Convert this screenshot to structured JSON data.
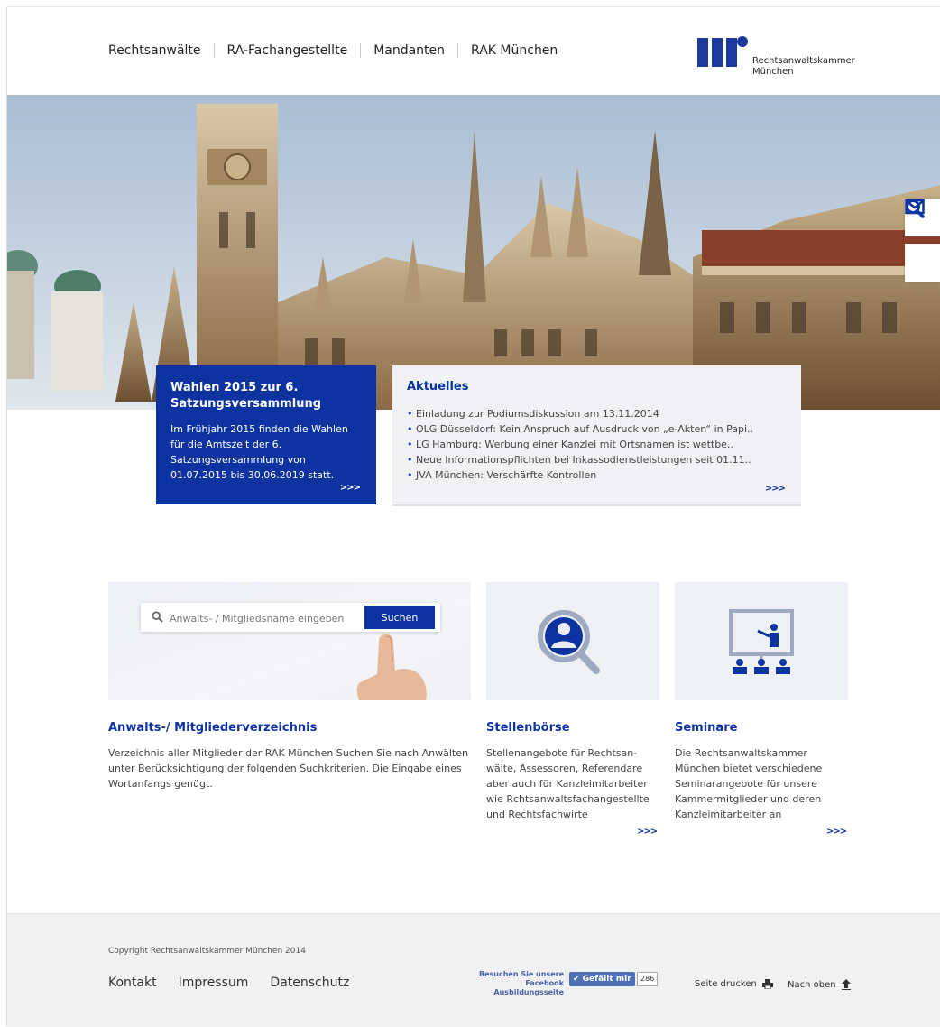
{
  "header": {
    "nav": [
      "Rechtsanwälte",
      "RA-Fachangestellte",
      "Mandanten",
      "RAK München"
    ],
    "logo_line1": "Rechtsanwaltskammer",
    "logo_line2": "München"
  },
  "wahlen": {
    "title": "Wahlen 2015 zur 6. Satzungsversammlung",
    "text": "Im Frühjahr 2015 finden die Wahlen für die Amtszeit der 6. Satzungsversammlung von 01.07.2015 bis 30.06.2019 statt.",
    "more": ">>>"
  },
  "aktuelles": {
    "title": "Aktuelles",
    "items": [
      "Einladung zur Podiumsdiskussion am 13.11.2014",
      "OLG Düsseldorf: Kein Anspruch auf Ausdruck von „e-Akten“ in Papi..",
      "LG Hamburg: Werbung einer Kanzlei mit Ortsnamen ist wettbe..",
      "Neue Informationspflichten bei Inkassodienstleistungen seit 01.11..",
      "JVA München: Verschärfte Kontrollen"
    ],
    "more": ">>>"
  },
  "search": {
    "placeholder": "Anwalts- / Mitgliedsname eingeben",
    "button": "Suchen"
  },
  "columns": [
    {
      "title": "Anwalts-/ Mitgliederverzeichnis",
      "text": "Verzeichnis aller Mitglieder der RAK München Suchen Sie nach Anwälten unter Berücksichtigung der folgenden Suchkriterien. Die Eingabe eines Wortanfangs genügt."
    },
    {
      "title": "Stellenbörse",
      "text": "Stellenangebote für Rechtsan-wälte, Assessoren, Referendare aber auch für Kanzleimitarbeiter wie Rchtsanwaltsfachangestellte und Rechtsfachwirte",
      "more": ">>>"
    },
    {
      "title": "Seminare",
      "text": "Die Rechtsanwaltskammer München bietet verschiedene Seminarangebote für unsere Kammermitglieder und deren Kanzleimitarbeiter an",
      "more": ">>>"
    }
  ],
  "footer": {
    "copyright": "Copyright Rechtsanwaltskammer München 2014",
    "nav": [
      "Kontakt",
      "Impressum",
      "Datenschutz"
    ],
    "fb_line1": "Besuchen Sie unsere",
    "fb_line2": "Facebook Ausbildungsseite",
    "fb_button": "✔ Gefällt mir",
    "fb_count": "286",
    "print": "Seite drucken",
    "top": "Nach oben"
  },
  "colors": {
    "brand": "#0d33a0",
    "panel": "#f0f1f4"
  },
  "icons": [
    "search-icon",
    "mail-icon",
    "person-search-icon",
    "presentation-icon",
    "printer-icon",
    "arrow-up-icon"
  ]
}
